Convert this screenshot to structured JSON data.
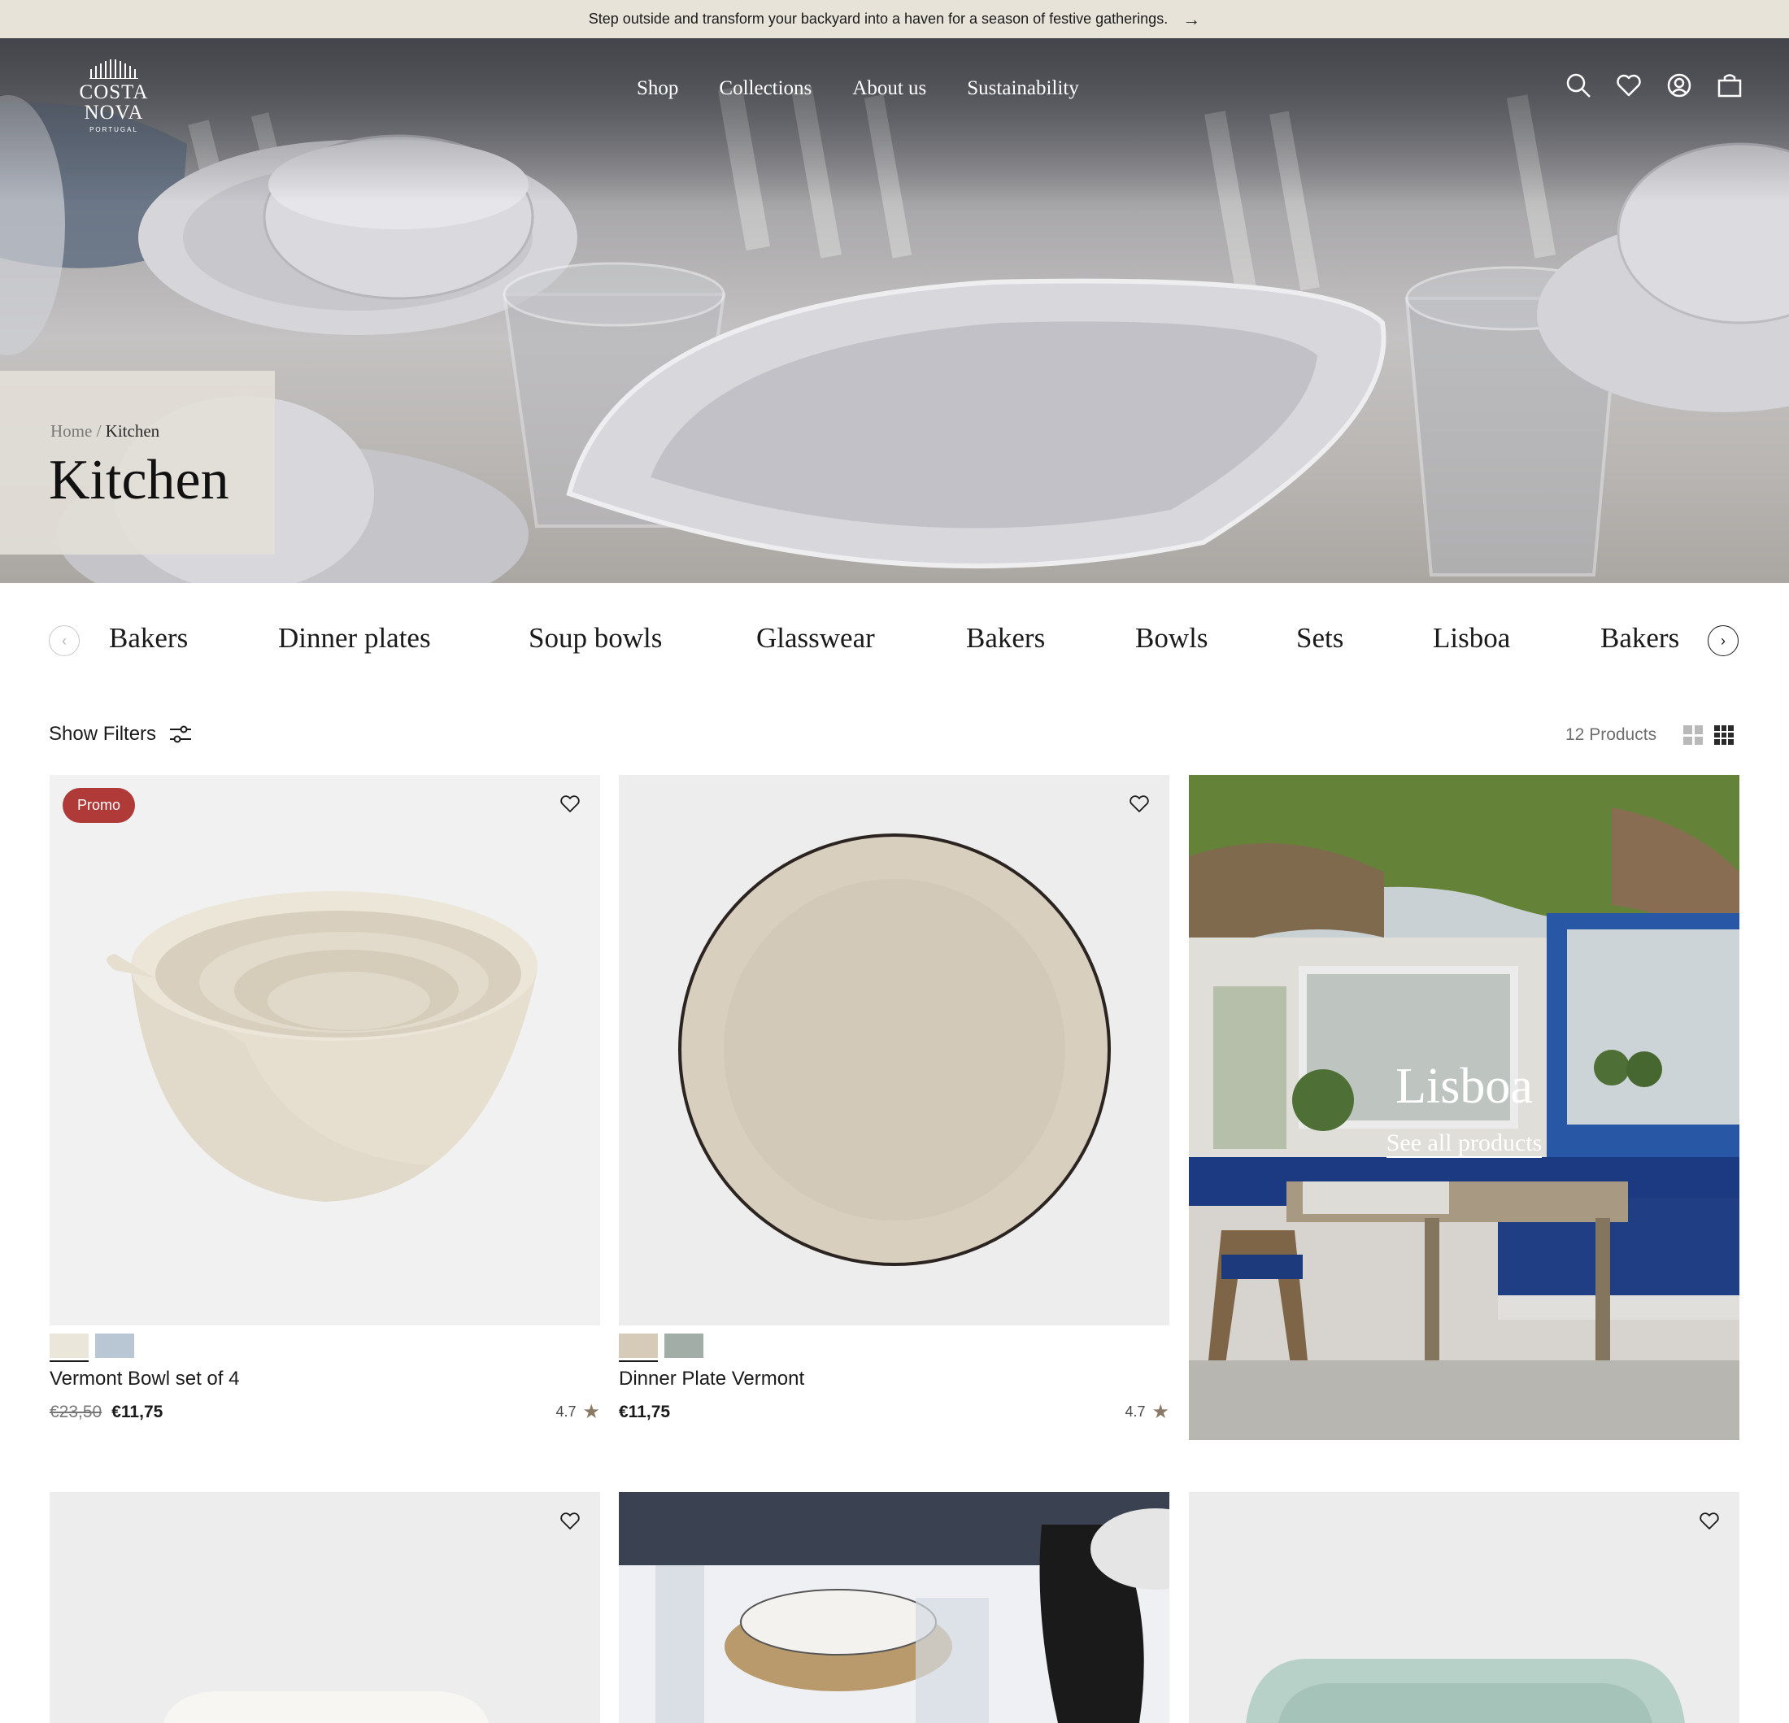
{
  "announcement": {
    "text": "Step outside and transform your backyard into a haven for a season of festive gatherings.",
    "arrow": "→"
  },
  "brand": {
    "name": "COSTA NOVA",
    "sub": "PORTUGAL"
  },
  "nav": [
    "Shop",
    "Collections",
    "About us",
    "Sustainability"
  ],
  "header_icons": [
    "search-icon",
    "heart-icon",
    "account-icon",
    "bag-icon"
  ],
  "breadcrumb": {
    "home": "Home",
    "separator": "/",
    "current": "Kitchen"
  },
  "page_title": "Kitchen",
  "categories": [
    "Bakers",
    "Dinner plates",
    "Soup bowls",
    "Glasswear",
    "Bakers",
    "Bowls",
    "Sets",
    "Lisboa",
    "Bakers"
  ],
  "toolbar": {
    "filters_label": "Show Filters",
    "count_label": "12 Products"
  },
  "products": [
    {
      "name": "Vermont Bowl set of 4",
      "badge": "Promo",
      "old_price": "€23,50",
      "price": "€11,75",
      "rating": "4.7",
      "swatches": [
        "#ebe6da",
        "#b9c6d4"
      ]
    },
    {
      "name": "Dinner Plate Vermont",
      "price": "€11,75",
      "rating": "4.7",
      "swatches": [
        "#d6cbb8",
        "#a1ada6"
      ]
    }
  ],
  "collection_banner": {
    "title": "Lisboa",
    "link": "See all products"
  },
  "colors": {
    "announce_bg": "#e8e3d9",
    "promo": "#b03a37",
    "star": "#8a7966"
  }
}
